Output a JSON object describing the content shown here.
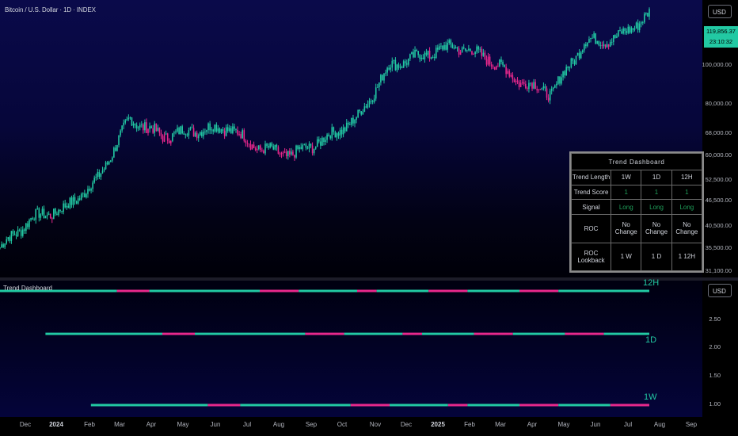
{
  "symbol_title": "Bitcoin / U.S. Dollar · 1D · INDEX",
  "currency_button": "USD",
  "current_price": "119,856.37",
  "countdown": "23:10:32",
  "price_axis": [
    "100,000.00",
    "80,000.00",
    "68,000.00",
    "60,000.00",
    "52,500.00",
    "46,500.00",
    "40,500.00",
    "35,500.00",
    "31,100.00"
  ],
  "indicator_title": "Trend Dashboard",
  "indicator_axis": [
    "2.50",
    "2.00",
    "1.50",
    "1.00"
  ],
  "trend_labels": {
    "h12": "12H",
    "d1": "1D",
    "w1": "1W"
  },
  "time_axis": [
    "Dec",
    "2024",
    "Feb",
    "Mar",
    "Apr",
    "May",
    "Jun",
    "Jul",
    "Aug",
    "Sep",
    "Oct",
    "Nov",
    "Dec",
    "2025",
    "Feb",
    "Mar",
    "Apr",
    "May",
    "Jun",
    "Jul",
    "Aug",
    "Sep"
  ],
  "dashboard": {
    "title": "Trend Dashboard",
    "columns": [
      "Trend Length",
      "1W",
      "1D",
      "12H"
    ],
    "rows": [
      [
        "Trend Score",
        "1",
        "1",
        "1"
      ],
      [
        "Signal",
        "Long",
        "Long",
        "Long"
      ],
      [
        "ROC",
        "No Change",
        "No Change",
        "No Change"
      ],
      [
        "ROC Lookback",
        "1 W",
        "1 D",
        "1 12H"
      ]
    ]
  },
  "colors": {
    "bull": "#22c9a3",
    "bear": "#e8288c",
    "long_text": "#1f9e59"
  },
  "chart_data": {
    "type": "line",
    "title": "Bitcoin / U.S. Dollar · 1D · INDEX",
    "x": [
      "Nov 2023",
      "Dec 2023",
      "Jan 2024",
      "Feb 2024",
      "Mar 2024",
      "Apr 2024",
      "May 2024",
      "Jun 2024",
      "Jul 2024",
      "Aug 2024",
      "Sep 2024",
      "Oct 2024",
      "Nov 2024",
      "Dec 2024",
      "Jan 2025",
      "Feb 2025",
      "Mar 2025",
      "Apr 2025",
      "May 2025",
      "Jun 2025",
      "Jul 2025"
    ],
    "series": [
      {
        "values": [
          36000,
          42000,
          44000,
          51000,
          70000,
          64000,
          66000,
          67000,
          60000,
          58000,
          63000,
          70000,
          92000,
          97000,
          102000,
          96000,
          85000,
          80000,
          104000,
          106000,
          119856
        ]
      }
    ],
    "ylim": [
      31100,
      125000
    ],
    "trend_dashboard_subpane": {
      "ylim": [
        0.9,
        2.7
      ],
      "series": [
        {
          "name": "12H",
          "value": 2.94
        },
        {
          "name": "1D",
          "value": 2.0
        },
        {
          "name": "1W",
          "value": 1.0
        }
      ]
    }
  }
}
